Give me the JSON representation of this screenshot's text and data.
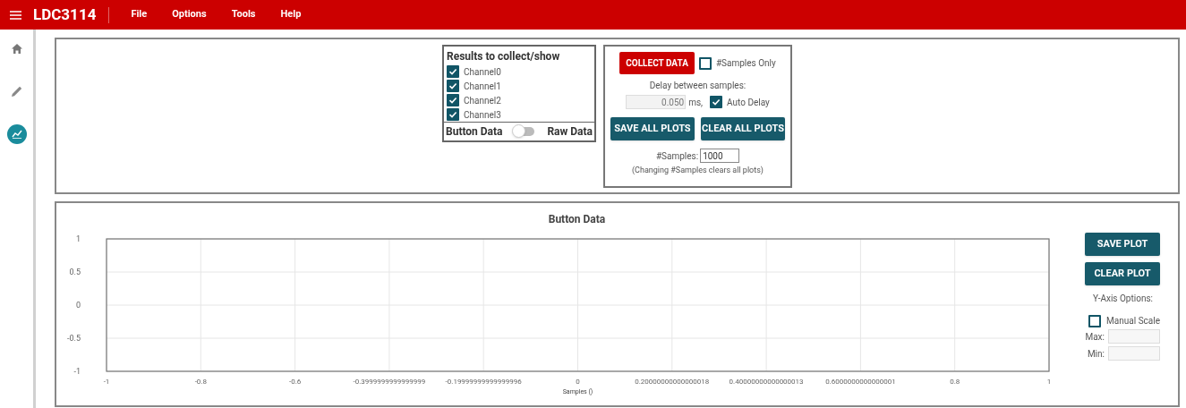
{
  "app_bar": {
    "title": "LDC3114",
    "menu": [
      "File",
      "Options",
      "Tools",
      "Help"
    ]
  },
  "sidebar": {
    "items": [
      {
        "kind": "home",
        "selected": false
      },
      {
        "kind": "edit",
        "selected": false
      },
      {
        "kind": "chart",
        "selected": true
      }
    ]
  },
  "results": {
    "title": "Results to collect/show",
    "channels": [
      {
        "label": "Channel0",
        "checked": true
      },
      {
        "label": "Channel1",
        "checked": true
      },
      {
        "label": "Channel2",
        "checked": true
      },
      {
        "label": "Channel3",
        "checked": true
      }
    ],
    "toggle": {
      "left": "Button Data",
      "right": "Raw Data",
      "on": false
    }
  },
  "collect": {
    "collect_button": "COLLECT DATA",
    "samples_only": {
      "label": "#Samples Only",
      "checked": false
    },
    "delay_label": "Delay between samples:",
    "delay_value": "0.050",
    "delay_unit": "ms,",
    "auto_delay": {
      "label": "Auto Delay",
      "checked": true
    },
    "save_all": "SAVE ALL PLOTS",
    "clear_all": "CLEAR ALL PLOTS",
    "samples_label": "#Samples:",
    "samples_value": "1000",
    "note": "(Changing #Samples clears all plots)"
  },
  "plot": {
    "chart_data": {
      "type": "line",
      "grid": true,
      "title": "Button Data",
      "xlabel": "Samples ()",
      "xlim": [
        -1,
        1
      ],
      "ylim": [
        -1,
        1
      ],
      "xticks": [
        {
          "value": -1,
          "label": "-1"
        },
        {
          "value": -0.8,
          "label": "-0.8"
        },
        {
          "value": -0.6,
          "label": "-0.6"
        },
        {
          "value": -0.4,
          "label": "-0.3999999999999999"
        },
        {
          "value": -0.2,
          "label": "-0.19999999999999996"
        },
        {
          "value": 0,
          "label": "0"
        },
        {
          "value": 0.2,
          "label": "0.20000000000000018"
        },
        {
          "value": 0.4,
          "label": "0.40000000000000013"
        },
        {
          "value": 0.6,
          "label": "0.6000000000000001"
        },
        {
          "value": 0.8,
          "label": "0.8"
        },
        {
          "value": 1,
          "label": "1"
        }
      ],
      "yticks": [
        {
          "value": 1,
          "label": "1"
        },
        {
          "value": 0.5,
          "label": "0.5"
        },
        {
          "value": 0,
          "label": "0"
        },
        {
          "value": -0.5,
          "label": "-0.5"
        },
        {
          "value": -1,
          "label": "-1"
        }
      ]
    },
    "save_button": "SAVE PLOT",
    "clear_button": "CLEAR PLOT",
    "y_axis_label": "Y-Axis Options:",
    "manual_scale": {
      "label": "Manual Scale",
      "checked": false
    },
    "max_label": "Max:",
    "min_label": "Min:"
  }
}
